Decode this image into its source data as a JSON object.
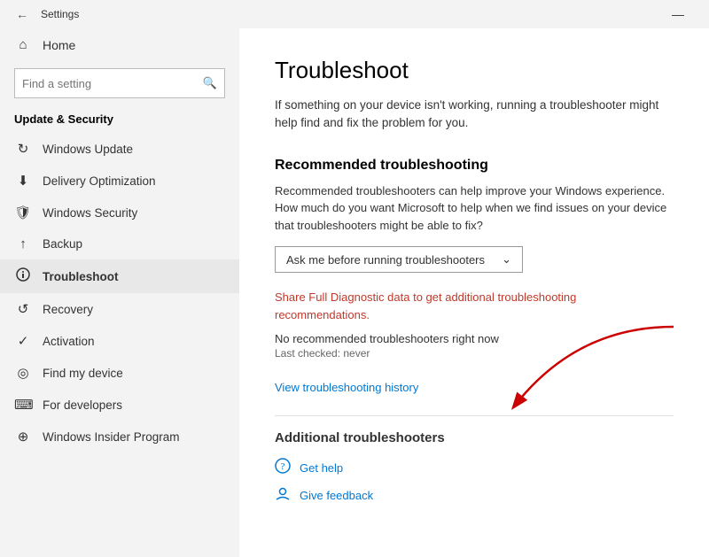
{
  "titlebar": {
    "title": "Settings",
    "minimize_label": "—"
  },
  "sidebar": {
    "search_placeholder": "Find a setting",
    "home_label": "Home",
    "section_title": "Update & Security",
    "items": [
      {
        "id": "windows-update",
        "label": "Windows Update",
        "icon": "↻"
      },
      {
        "id": "delivery-optimization",
        "label": "Delivery Optimization",
        "icon": "⬇"
      },
      {
        "id": "windows-security",
        "label": "Windows Security",
        "icon": "🛡"
      },
      {
        "id": "backup",
        "label": "Backup",
        "icon": "↑"
      },
      {
        "id": "troubleshoot",
        "label": "Troubleshoot",
        "icon": "👤"
      },
      {
        "id": "recovery",
        "label": "Recovery",
        "icon": "↺"
      },
      {
        "id": "activation",
        "label": "Activation",
        "icon": "✓"
      },
      {
        "id": "find-my-device",
        "label": "Find my device",
        "icon": "◎"
      },
      {
        "id": "for-developers",
        "label": "For developers",
        "icon": "⌨"
      },
      {
        "id": "windows-insider",
        "label": "Windows Insider Program",
        "icon": "⊕"
      }
    ]
  },
  "main": {
    "page_title": "Troubleshoot",
    "page_desc": "If something on your device isn't working, running a troubleshooter might help find and fix the problem for you.",
    "recommended_title": "Recommended troubleshooting",
    "recommended_desc": "Recommended troubleshooters can help improve your Windows experience. How much do you want Microsoft to help when we find issues on your device that troubleshooters might be able to fix?",
    "dropdown_label": "Ask me before running troubleshooters",
    "diagnostic_link": "Share Full Diagnostic data to get additional troubleshooting recommendations.",
    "no_troubleshooters": "No recommended troubleshooters right now",
    "last_checked": "Last checked: never",
    "history_link": "View troubleshooting history",
    "additional_title": "Additional troubleshooters",
    "get_help_label": "Get help",
    "feedback_label": "Give feedback"
  }
}
